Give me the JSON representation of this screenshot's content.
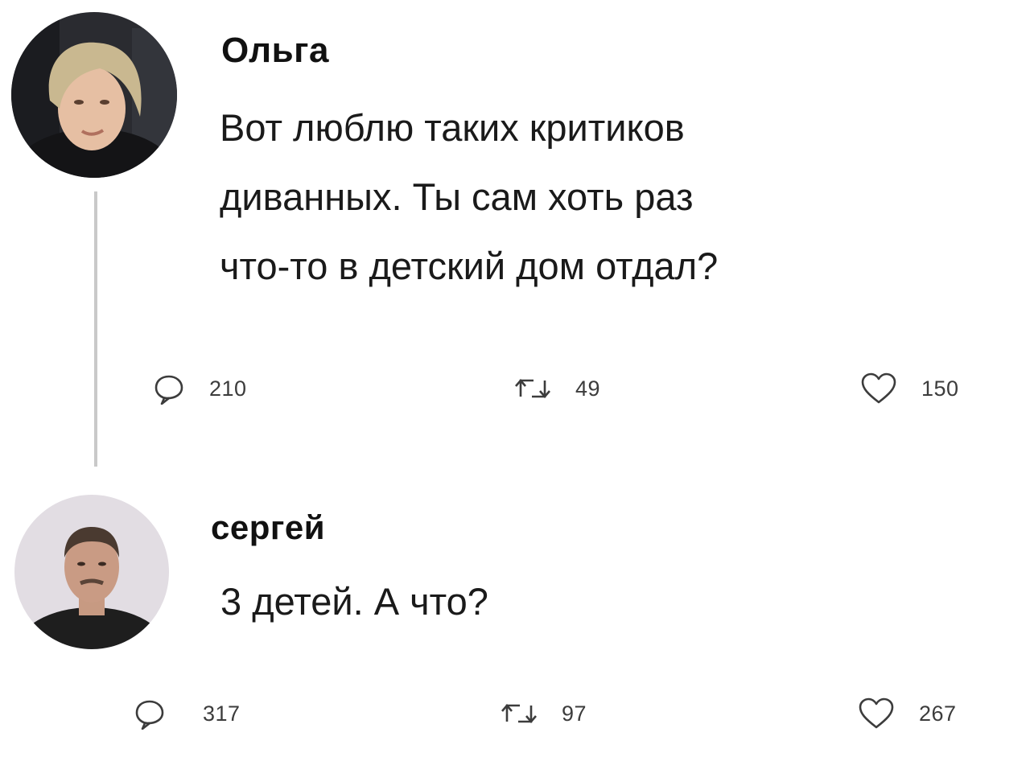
{
  "posts": [
    {
      "author": "Ольга",
      "text": "Вот люблю таких критиков\nдиванных. Ты сам хоть раз\nчто-то в детский дом отдал?",
      "replies": "210",
      "reposts": "49",
      "likes": "150"
    },
    {
      "author": "сергей",
      "text": "3 детей. А что?",
      "replies": "317",
      "reposts": "97",
      "likes": "267"
    }
  ],
  "icons": {
    "reply": "speech-bubble-icon",
    "repost": "repost-arrows-icon",
    "like": "heart-icon"
  },
  "colors": {
    "thread_line": "#c9c9c9",
    "icon_stroke": "#3c3c3c"
  }
}
